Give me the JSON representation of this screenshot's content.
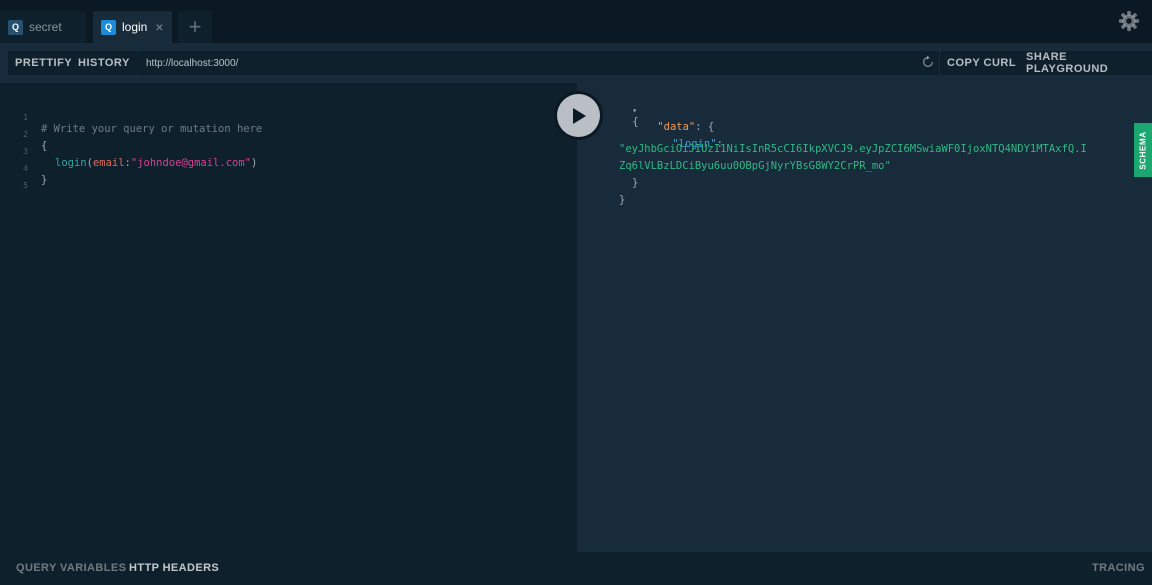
{
  "tabs": [
    {
      "badge": "Q",
      "label": "secret",
      "active": false
    },
    {
      "badge": "Q",
      "label": "login",
      "active": true,
      "close": "×"
    }
  ],
  "add_tab_label": "+",
  "toolbar": {
    "prettify_label": "PRETTIFY",
    "history_label": "HISTORY",
    "url": "http://localhost:3000/",
    "copy_curl_label": "COPY CURL",
    "share_label": "SHARE PLAYGROUND"
  },
  "editor": {
    "line_numbers": [
      "1",
      "2",
      "3",
      "4",
      "5"
    ],
    "comment": "# Write your query or mutation here",
    "open_brace": "{",
    "field": "login",
    "paren_open": "(",
    "arg_name": "email",
    "colon": ":",
    "arg_value": "\"johndoe@gmail.com\"",
    "paren_close": ")",
    "close_brace": "}"
  },
  "result": {
    "collapse_arrow": "▾",
    "open_brace": "{",
    "data_key": "\"data\"",
    "data_sep": ": {",
    "login_key": "\"login\"",
    "login_sep": ":",
    "token_line1": "\"eyJhbGciOiJIUzI1NiIsInR5cCI6IkpXVCJ9.eyJpZCI6MSwiaWF0IjoxNTQ4NDY1MTAxfQ.I",
    "token_line2": "Zq6lVLBzLDCiByu6uu0OBpGjNyrYBsG8WY2CrPR_mo\"",
    "inner_close": "}",
    "outer_close": "}"
  },
  "schema_tab_label": "SCHEMA",
  "bottom": {
    "query_variables_label": "QUERY VARIABLES",
    "http_headers_label": "HTTP HEADERS",
    "tracing_label": "TRACING"
  },
  "colors": {
    "background": "#0b1924",
    "editor_bg": "#0f202d",
    "result_bg": "#172b3a",
    "accent_blue": "#1a8cd8",
    "schema_green": "#1ca670"
  },
  "icons": {
    "settings": "gear-icon",
    "reload": "reload-icon",
    "execute": "play-icon"
  }
}
